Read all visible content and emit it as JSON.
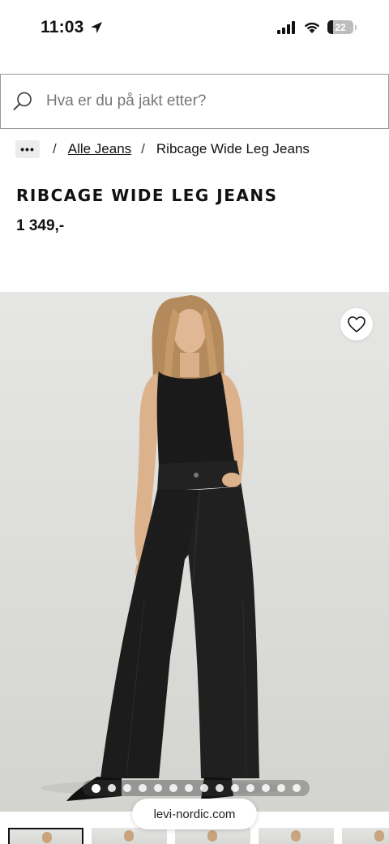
{
  "status_bar": {
    "time": "11:03",
    "battery": "22",
    "battery_level": 0.22
  },
  "search": {
    "placeholder": "Hva er du på jakt etter?"
  },
  "breadcrumb": {
    "more": "•••",
    "separator": "/",
    "category": "Alle Jeans",
    "current": "Ribcage Wide Leg Jeans"
  },
  "product": {
    "title": "RIBCAGE WIDE LEG JEANS",
    "price": "1 349,-"
  },
  "gallery": {
    "image_count": 14,
    "active_index": 0
  },
  "browser": {
    "url": "levi-nordic.com"
  },
  "colors": {
    "text": "#111111",
    "search_border": "#9a9a9a",
    "breadcrumb_chip": "#ececec",
    "garment": "#1c1c1c"
  },
  "icons": {
    "location": "location-arrow-icon",
    "signal": "cellular-signal-icon",
    "wifi": "wifi-icon",
    "battery": "battery-icon",
    "search": "search-icon",
    "wishlist": "heart-icon"
  }
}
